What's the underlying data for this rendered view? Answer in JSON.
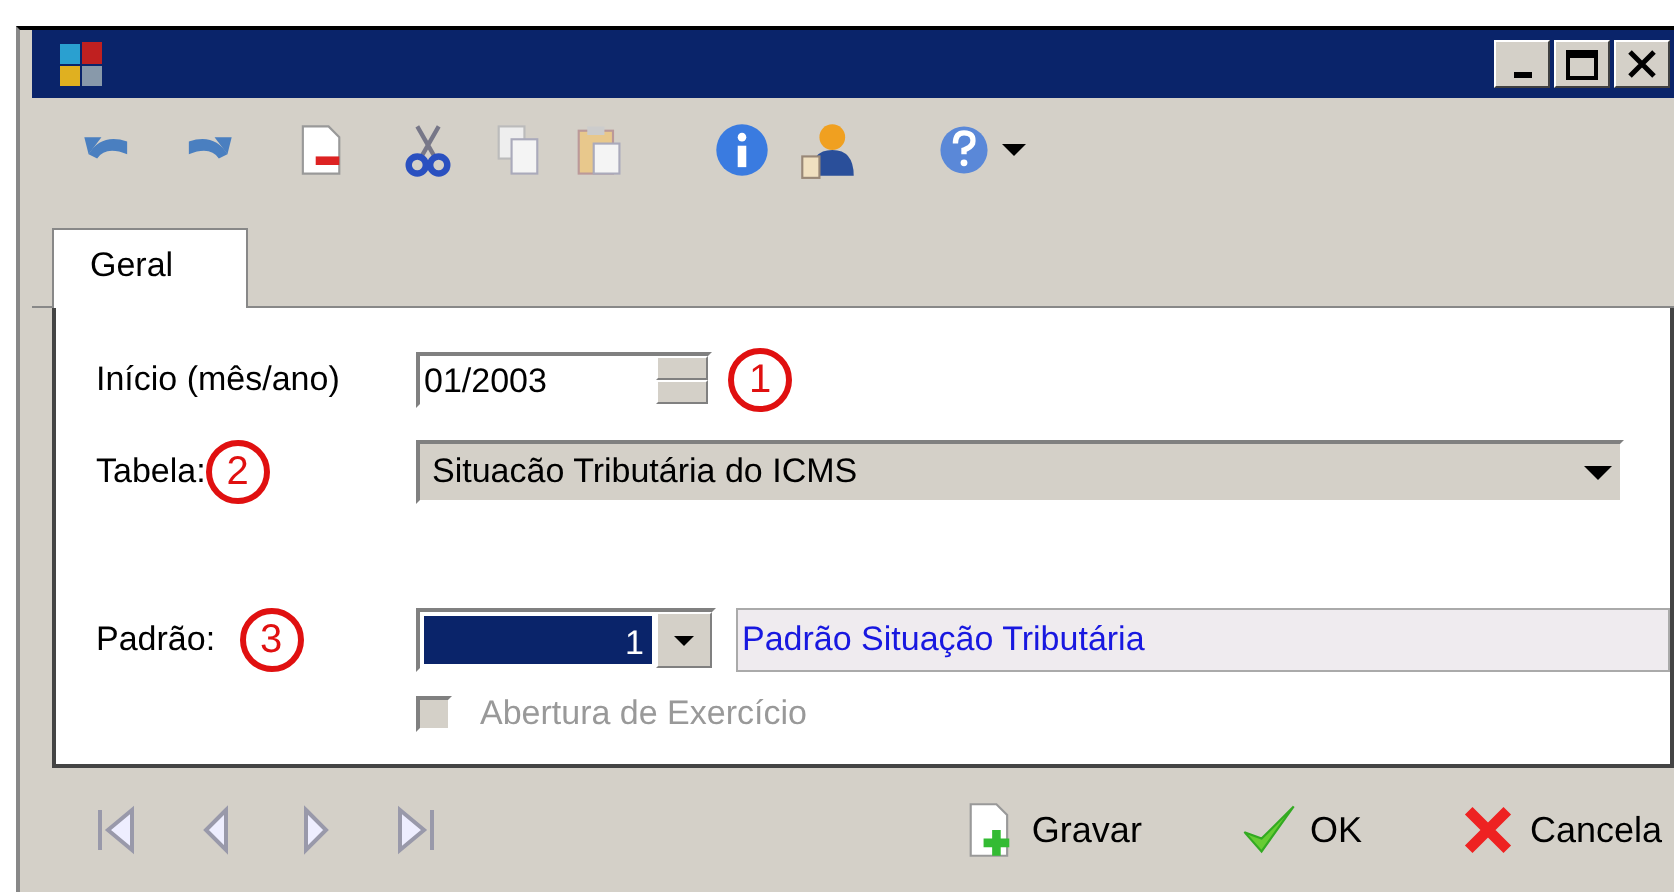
{
  "window": {
    "controls": [
      {
        "kind": "minimize"
      },
      {
        "kind": "maximize"
      },
      {
        "kind": "close"
      }
    ]
  },
  "toolbar": {
    "items": [
      {
        "kind": "undo"
      },
      {
        "kind": "redo"
      },
      {
        "kind": "delete"
      },
      {
        "kind": "cut"
      },
      {
        "kind": "copy"
      },
      {
        "kind": "paste"
      },
      {
        "kind": "info"
      },
      {
        "kind": "user"
      },
      {
        "kind": "help"
      },
      {
        "kind": "dropdown"
      }
    ]
  },
  "tabs": [
    {
      "label": "Geral",
      "selected": true
    }
  ],
  "form": {
    "inicio": {
      "label": "Início (mês/ano)",
      "value": "01/2003",
      "marker": "1"
    },
    "tabela": {
      "label": "Tabela:",
      "marker": "2",
      "value": "Situacão Tributária do ICMS"
    },
    "padrao": {
      "label": "Padrão:",
      "marker": "3",
      "code": "1",
      "code_selected": true,
      "description": "Padrão Situação Tributária"
    },
    "checkbox": {
      "label": "Abertura de Exercício",
      "checked": false,
      "disabled": true
    }
  },
  "navigation": [
    {
      "kind": "first"
    },
    {
      "kind": "previous"
    },
    {
      "kind": "next"
    },
    {
      "kind": "last"
    }
  ],
  "buttons": [
    {
      "kind": "save",
      "label": "Gravar"
    },
    {
      "kind": "ok",
      "label": "OK"
    },
    {
      "kind": "cancel",
      "label": "Cancela"
    }
  ]
}
